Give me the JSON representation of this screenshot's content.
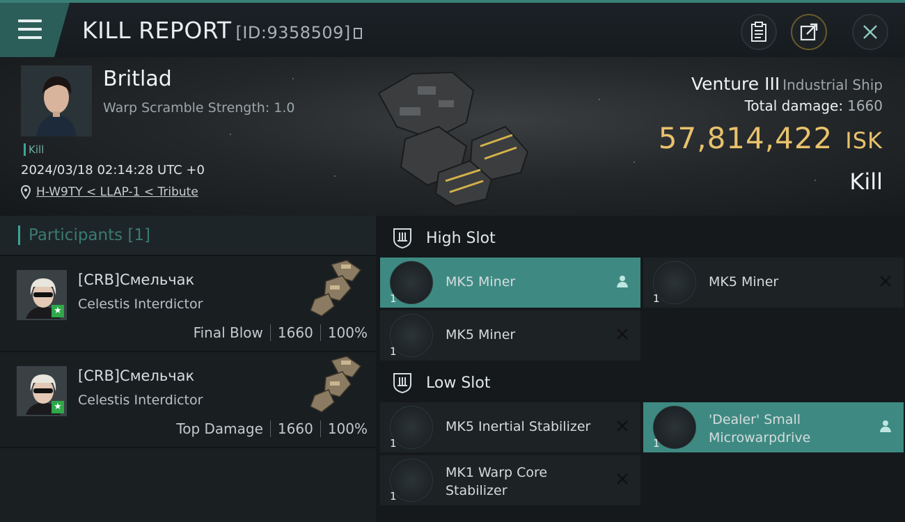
{
  "header": {
    "title": "KILL REPORT",
    "report_id": "[ID:9358509]",
    "icons": [
      "menu-icon",
      "clipboard-icon",
      "share-icon",
      "close-icon"
    ]
  },
  "victim": {
    "name": "Britlad",
    "warp_scramble": "Warp Scramble Strength: 1.0",
    "tag": "Kill",
    "datetime": "2024/03/18 02:14:28 UTC +0",
    "location": "H-W9TY < LLAP-1 < Tribute",
    "ship_name": "Venture III",
    "ship_class": "Industrial Ship",
    "total_damage_label": "Total damage:",
    "total_damage_value": "1660",
    "isk_value": "57,814,422",
    "isk_unit": "ISK",
    "result": "Kill"
  },
  "participants": {
    "label": "Participants [1]",
    "rows": [
      {
        "name": "[CRB]Смельчак",
        "ship": "Celestis Interdictor",
        "role": "Final Blow",
        "damage": "1660",
        "percent": "100%"
      },
      {
        "name": "[CRB]Смельчак",
        "ship": "Celestis Interdictor",
        "role": "Top Damage",
        "damage": "1660",
        "percent": "100%"
      }
    ]
  },
  "fitting": {
    "high_slot_label": "High Slot",
    "low_slot_label": "Low Slot",
    "high": [
      {
        "name": "MK5 Miner",
        "qty": "1",
        "status": "person-icon",
        "highlighted": true
      },
      {
        "name": "MK5 Miner",
        "qty": "1",
        "status": "destroyed-x-icon",
        "highlighted": false
      },
      {
        "name": "MK5 Miner",
        "qty": "1",
        "status": "destroyed-x-icon",
        "highlighted": false
      }
    ],
    "low": [
      {
        "name": "MK5 Inertial Stabilizer",
        "qty": "1",
        "status": "destroyed-x-icon",
        "highlighted": false
      },
      {
        "name": "'Dealer' Small Microwarpdrive",
        "qty": "1",
        "status": "person-icon",
        "highlighted": true
      },
      {
        "name": "MK1 Warp Core Stabilizer",
        "qty": "1",
        "status": "destroyed-x-icon",
        "highlighted": false
      }
    ]
  },
  "colors": {
    "accent": "#3fa396",
    "isk": "#e8c26c",
    "highlight_row": "#3e8a82"
  }
}
